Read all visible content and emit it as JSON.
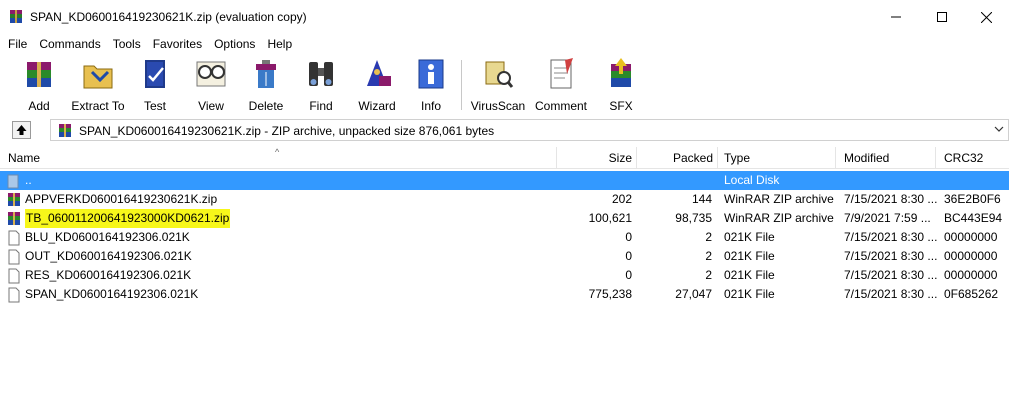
{
  "window": {
    "title": "SPAN_KD060016419230621K.zip (evaluation copy)",
    "app_icon": "winrar-icon"
  },
  "menu": [
    "File",
    "Commands",
    "Tools",
    "Favorites",
    "Options",
    "Help"
  ],
  "toolbar": [
    {
      "label": "Add",
      "icon": "add-archive-icon"
    },
    {
      "label": "Extract To",
      "icon": "extract-folder-icon"
    },
    {
      "label": "Test",
      "icon": "test-book-icon"
    },
    {
      "label": "View",
      "icon": "view-glasses-icon"
    },
    {
      "label": "Delete",
      "icon": "delete-icon"
    },
    {
      "label": "Find",
      "icon": "binoculars-icon"
    },
    {
      "label": "Wizard",
      "icon": "wizard-icon"
    },
    {
      "label": "Info",
      "icon": "info-icon"
    },
    {
      "label": "VirusScan",
      "icon": "virusscan-icon"
    },
    {
      "label": "Comment",
      "icon": "comment-icon"
    },
    {
      "label": "SFX",
      "icon": "sfx-icon"
    }
  ],
  "address": {
    "text": "SPAN_KD060016419230621K.zip - ZIP archive, unpacked size 876,061 bytes"
  },
  "columns": {
    "name": "Name",
    "size": "Size",
    "packed": "Packed",
    "type": "Type",
    "modified": "Modified",
    "crc": "CRC32"
  },
  "rows": [
    {
      "name": "..",
      "size": "",
      "packed": "",
      "type": "Local Disk",
      "modified": "",
      "crc": "",
      "icon": "parent-folder-icon",
      "selected": true
    },
    {
      "name": "APPVERKD060016419230621K.zip",
      "size": "202",
      "packed": "144",
      "type": "WinRAR ZIP archive",
      "modified": "7/15/2021 8:30 ...",
      "crc": "36E2B0F6",
      "icon": "zip-archive-icon"
    },
    {
      "name": "TB_060011200641923000KD0621.zip",
      "size": "100,621",
      "packed": "98,735",
      "type": "WinRAR ZIP archive",
      "modified": "7/9/2021 7:59 ...",
      "crc": "BC443E94",
      "icon": "zip-archive-icon",
      "highlighted": true
    },
    {
      "name": "BLU_KD0600164192306.021K",
      "size": "0",
      "packed": "2",
      "type": "021K File",
      "modified": "7/15/2021 8:30 ...",
      "crc": "00000000",
      "icon": "file-icon"
    },
    {
      "name": "OUT_KD0600164192306.021K",
      "size": "0",
      "packed": "2",
      "type": "021K File",
      "modified": "7/15/2021 8:30 ...",
      "crc": "00000000",
      "icon": "file-icon"
    },
    {
      "name": "RES_KD0600164192306.021K",
      "size": "0",
      "packed": "2",
      "type": "021K File",
      "modified": "7/15/2021 8:30 ...",
      "crc": "00000000",
      "icon": "file-icon"
    },
    {
      "name": "SPAN_KD0600164192306.021K",
      "size": "775,238",
      "packed": "27,047",
      "type": "021K File",
      "modified": "7/15/2021 8:30 ...",
      "crc": "0F685262",
      "icon": "file-icon"
    }
  ],
  "colors": {
    "selection": "#3399ff",
    "highlight": "#f7f71a"
  }
}
